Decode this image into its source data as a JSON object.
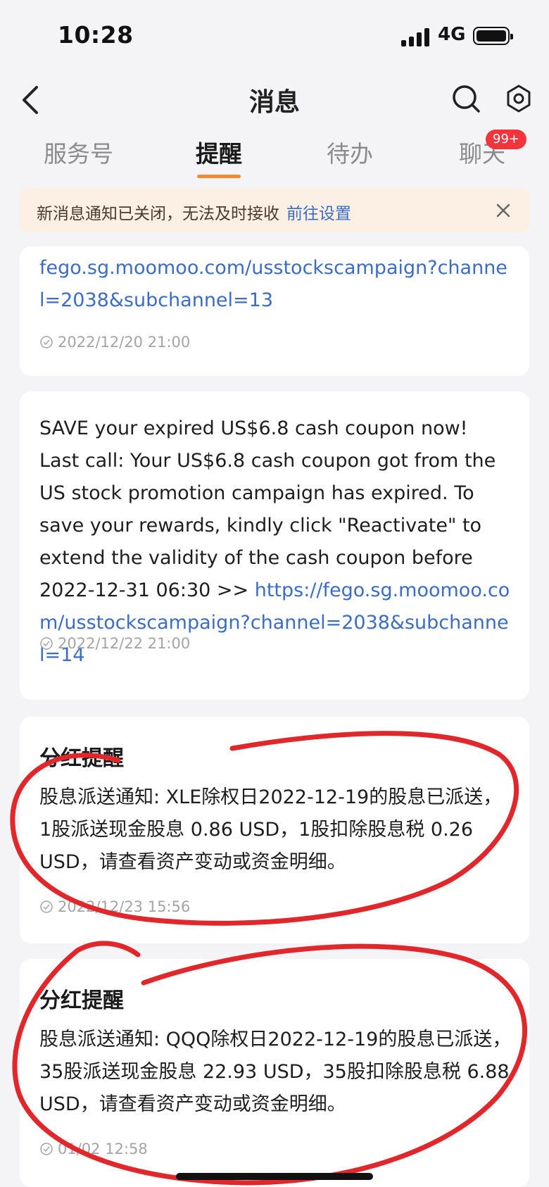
{
  "status_bar": {
    "time": "10:28",
    "network": "4G",
    "battery_level_pct": 100
  },
  "header": {
    "title": "消息",
    "back_icon": "chevron-left-icon",
    "search_icon": "search-icon",
    "settings_icon": "hexagon-gear-icon"
  },
  "tabs": [
    {
      "label": "服务号",
      "active": false
    },
    {
      "label": "提醒",
      "active": true
    },
    {
      "label": "待办",
      "active": false
    },
    {
      "label": "聊天",
      "active": false,
      "badge": "99+"
    }
  ],
  "banner": {
    "text": "新消息通知已关闭，无法及时接收",
    "link": "前往设置",
    "close_icon": "close-icon"
  },
  "messages": [
    {
      "partial_link": "fego.sg.moomoo.com/usstockscampaign?channel=2038&subchannel=13",
      "time": "2022/12/20 21:00"
    },
    {
      "text": "SAVE your expired US$6.8 cash coupon now! Last call: Your US$6.8 cash coupon got from the US stock promotion campaign has expired. To save your rewards, kindly click \"Reactivate\" to extend the validity of the cash coupon before 2022-12-31 06:30 >> ",
      "link": "https://fego.sg.moomoo.com/usstockscampaign?channel=2038&subchannel=14",
      "time": "2022/12/22 21:00"
    },
    {
      "title": "分红提醒",
      "text": "股息派送通知: XLE除权日2022-12-19的股息已派送，1股派送现金股息 0.86 USD，1股扣除股息税 0.26 USD，请查看资产变动或资金明细。",
      "time": "2022/12/23 15:56"
    },
    {
      "title": "分红提醒",
      "text": "股息派送通知: QQQ除权日2022-12-19的股息已派送，35股派送现金股息 22.93 USD，35股扣除股息税 6.88 USD，请查看资产变动或资金明细。",
      "time": "01/02 12:58"
    }
  ],
  "colors": {
    "accent": "#f28a34",
    "link": "#3c6cc4",
    "badge": "#f2353c",
    "annotation": "#e0282c",
    "background": "#f4f4f6"
  }
}
